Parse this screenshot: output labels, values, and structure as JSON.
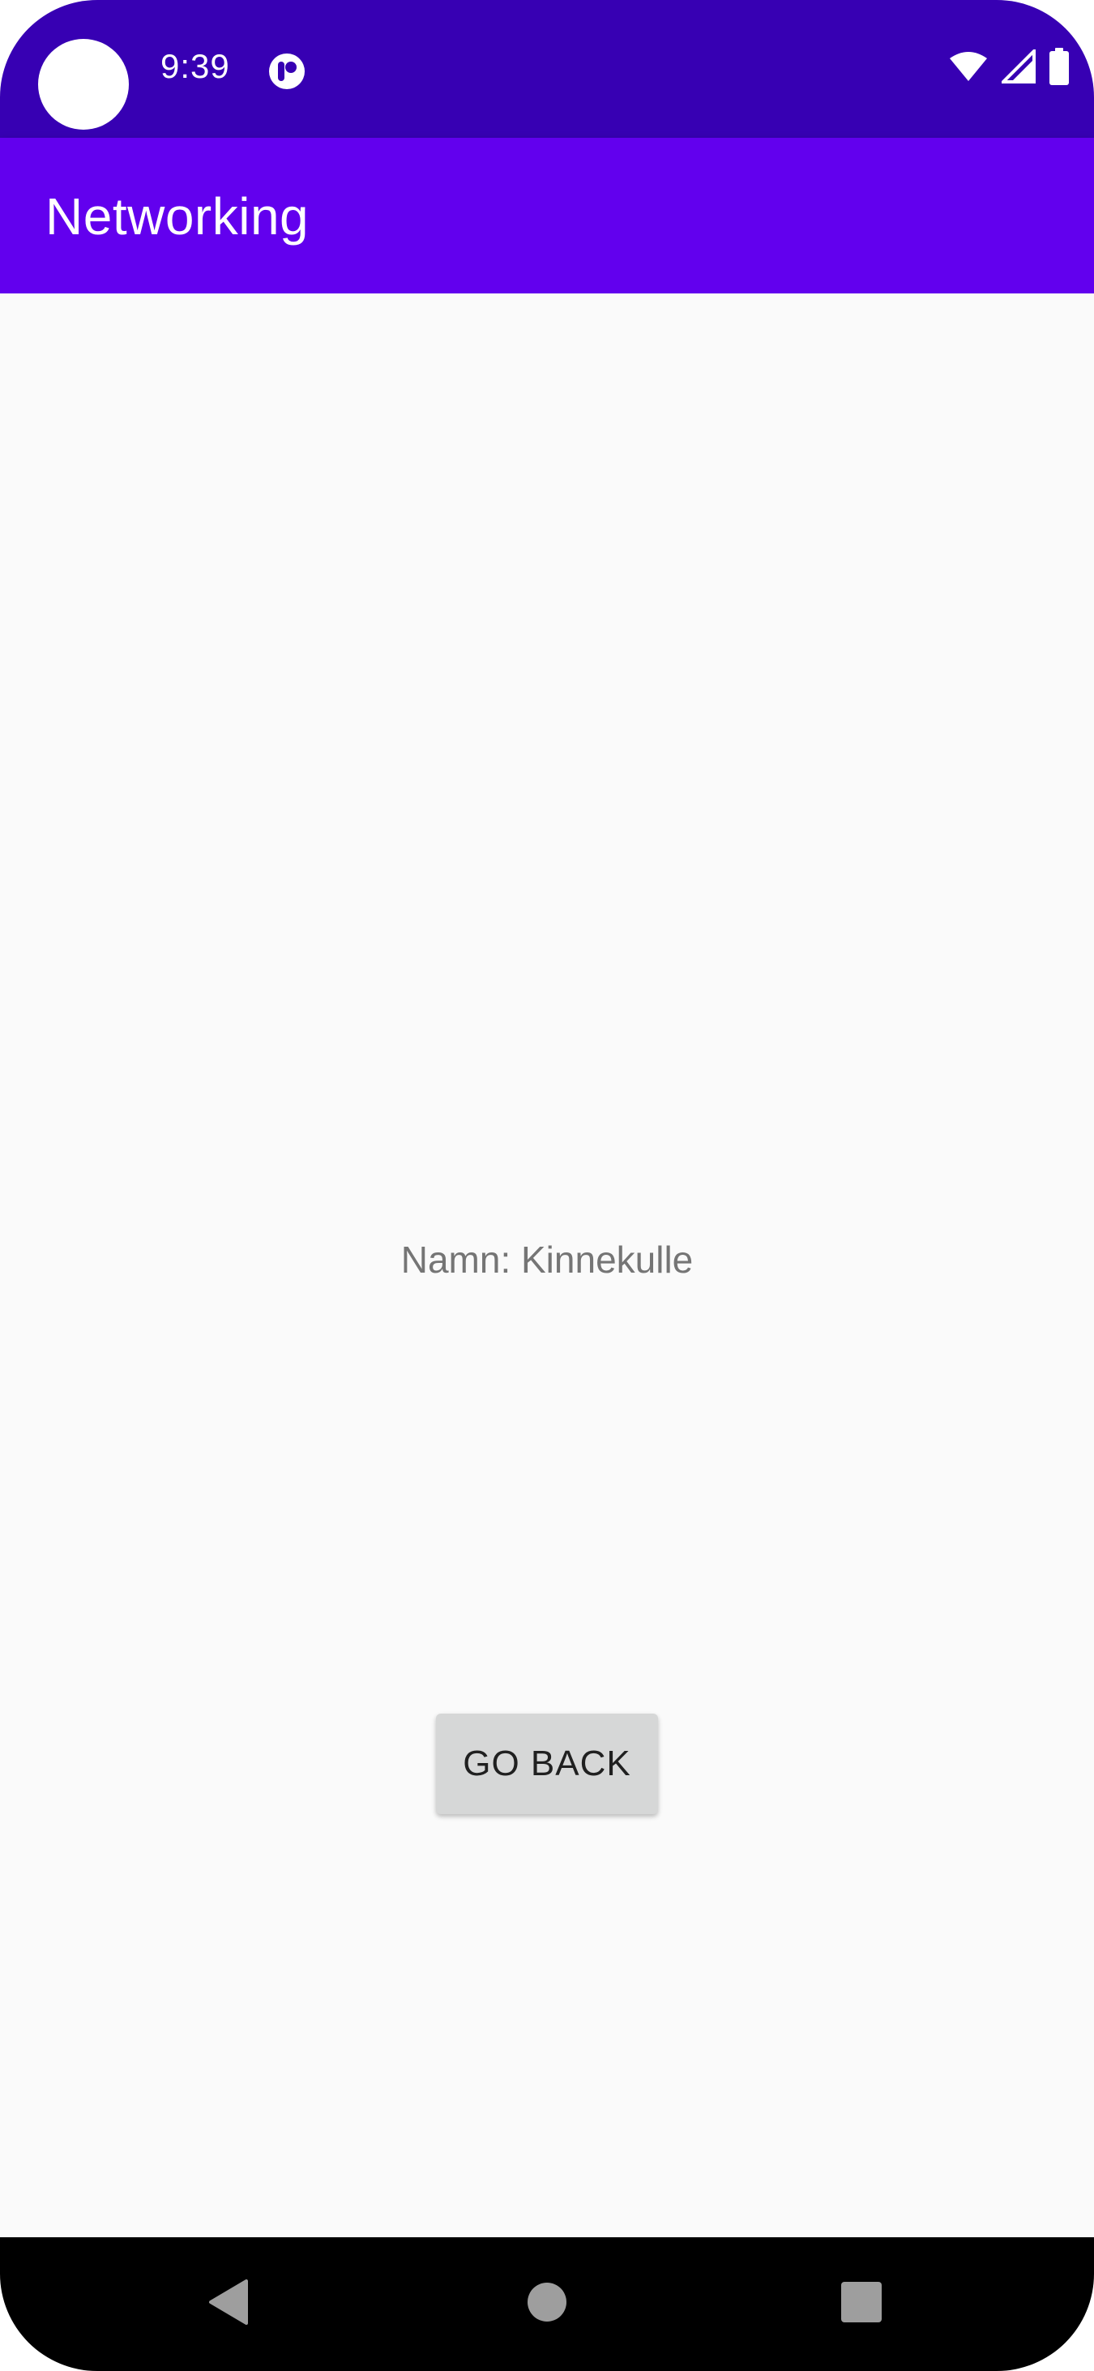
{
  "status_bar": {
    "time": "9:39",
    "background_color": "#3700b3",
    "icons": [
      "app-notification-icon",
      "wifi-icon",
      "cellular-signal-icon",
      "battery-icon"
    ]
  },
  "app_bar": {
    "title": "Networking",
    "background_color": "#6200ee"
  },
  "content": {
    "name_text": "Namn: Kinnekulle",
    "go_back_label": "GO BACK"
  },
  "nav_bar": {
    "buttons": [
      "back-icon",
      "home-icon",
      "recents-icon"
    ]
  }
}
